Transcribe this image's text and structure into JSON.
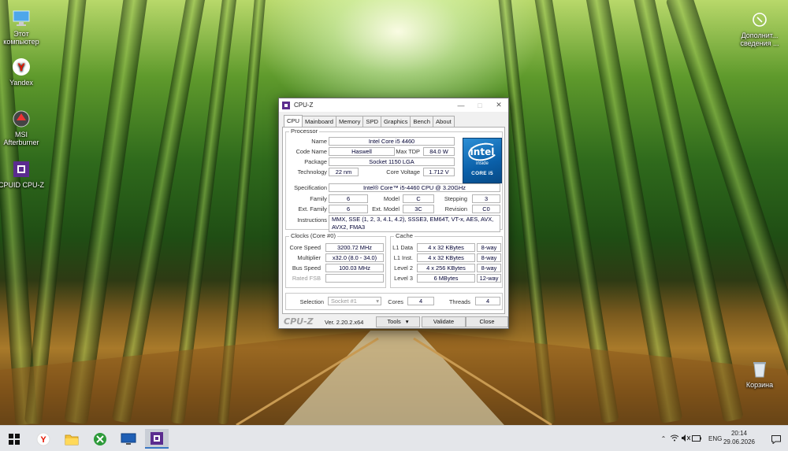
{
  "desktop": {
    "icons": [
      {
        "label": "Этот компьютер",
        "icon": "computer-icon"
      },
      {
        "label": "Yandex",
        "icon": "yandex-icon"
      },
      {
        "label": "MSI Afterburner",
        "icon": "afterburner-icon"
      },
      {
        "label": "CPUID CPU-Z",
        "icon": "cpuz-icon"
      },
      {
        "label": "Дополнит... сведения ...",
        "icon": "info-icon"
      },
      {
        "label": "Корзина",
        "icon": "recycle-bin-icon"
      }
    ]
  },
  "window": {
    "title": "CPU-Z",
    "tabs": [
      "CPU",
      "Mainboard",
      "Memory",
      "SPD",
      "Graphics",
      "Bench",
      "About"
    ],
    "active_tab": "CPU",
    "processor": {
      "group_title": "Processor",
      "name_label": "Name",
      "name": "Intel Core i5 4460",
      "codename_label": "Code Name",
      "codename": "Haswell",
      "maxtdp_label": "Max TDP",
      "maxtdp": "84.0 W",
      "package_label": "Package",
      "package": "Socket 1150 LGA",
      "technology_label": "Technology",
      "technology": "22 nm",
      "voltage_label": "Core Voltage",
      "voltage": "1.712 V",
      "spec_label": "Specification",
      "spec": "Intel® Core™ i5-4460  CPU @ 3.20GHz",
      "family_label": "Family",
      "family": "6",
      "model_label": "Model",
      "model": "C",
      "stepping_label": "Stepping",
      "stepping": "3",
      "extfamily_label": "Ext. Family",
      "extfamily": "6",
      "extmodel_label": "Ext. Model",
      "extmodel": "3C",
      "revision_label": "Revision",
      "revision": "C0",
      "instructions_label": "Instructions",
      "instructions": "MMX, SSE (1, 2, 3, 4.1, 4.2), SSSE3, EM64T, VT-x, AES, AVX, AVX2, FMA3",
      "logo": {
        "brand": "intel",
        "inside": "inside",
        "core": "CORE i5",
        "color": "#0a5fa8"
      }
    },
    "clocks": {
      "group_title": "Clocks (Core #0)",
      "corespeed_label": "Core Speed",
      "corespeed": "3200.72 MHz",
      "multiplier_label": "Multiplier",
      "multiplier": "x32.0 (8.0 - 34.0)",
      "busspeed_label": "Bus Speed",
      "busspeed": "100.03 MHz",
      "ratedfsb_label": "Rated FSB",
      "ratedfsb": ""
    },
    "cache": {
      "group_title": "Cache",
      "rows": [
        {
          "label": "L1 Data",
          "size": "4 x 32 KBytes",
          "way": "8-way"
        },
        {
          "label": "L1 Inst.",
          "size": "4 x 32 KBytes",
          "way": "8-way"
        },
        {
          "label": "Level 2",
          "size": "4 x 256 KBytes",
          "way": "8-way"
        },
        {
          "label": "Level 3",
          "size": "6 MBytes",
          "way": "12-way"
        }
      ]
    },
    "selection": {
      "selection_label": "Selection",
      "selection": "Socket #1",
      "cores_label": "Cores",
      "cores": "4",
      "threads_label": "Threads",
      "threads": "4"
    },
    "footer": {
      "brand": "CPU-Z",
      "version": "Ver. 2.20.2.x64",
      "tools": "Tools",
      "validate": "Validate",
      "close": "Close"
    }
  },
  "taskbar": {
    "apps": [
      "start-icon",
      "yandex-icon",
      "file-explorer-icon",
      "xbox-icon",
      "monitor-icon",
      "cpuz-icon"
    ],
    "active_app": "cpuz-icon",
    "language": "ENG",
    "time": "20:14",
    "date": "29.06.2026",
    "accent": "#3b78c4"
  }
}
